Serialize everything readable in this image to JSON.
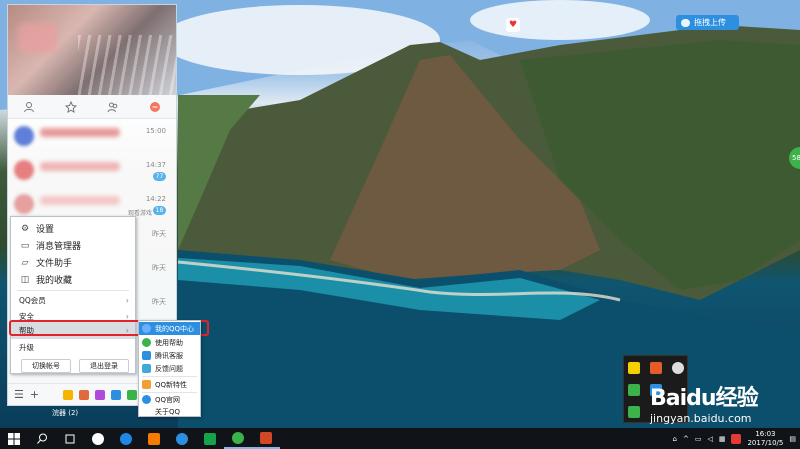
{
  "desktop": {
    "upload_button": "拖拽上传"
  },
  "qq": {
    "chats": [
      {
        "time": "15:00",
        "badge": "",
        "snippet": ""
      },
      {
        "time": "14:37",
        "badge": "77",
        "snippet": ""
      },
      {
        "time": "14:22",
        "badge": "18",
        "snippet": "观看游戏"
      },
      {
        "time": "昨天",
        "badge": "",
        "snippet": ""
      },
      {
        "time": "昨天",
        "badge": "",
        "snippet": ""
      },
      {
        "time": "昨天",
        "badge": "",
        "snippet": ""
      }
    ],
    "status_text": "浣器 (2)"
  },
  "main_menu": {
    "settings": "设置",
    "message_manager": "消息管理器",
    "file_assistant": "文件助手",
    "favorites": "我的收藏",
    "qq_vip": "QQ会员",
    "security": "安全",
    "help": "帮助",
    "upgrade": "升级",
    "switch_account": "切换帐号",
    "logout": "退出登录"
  },
  "help_menu": {
    "my_qq_center": "我的QQ中心",
    "usage_help": "使用帮助",
    "tencent_support": "腾讯客服",
    "feedback": "反馈问题",
    "new_features": "QQ新特性",
    "qq_official": "QQ官网",
    "about_qq": "关于QQ"
  },
  "watermark": {
    "logo": "Baidu经验",
    "url": "jingyan.baidu.com"
  },
  "taskbar": {
    "time": "16:03",
    "date": "2017/10/5"
  },
  "colors": {
    "accent": "#2d8fe0",
    "highlight": "#e0242e"
  }
}
